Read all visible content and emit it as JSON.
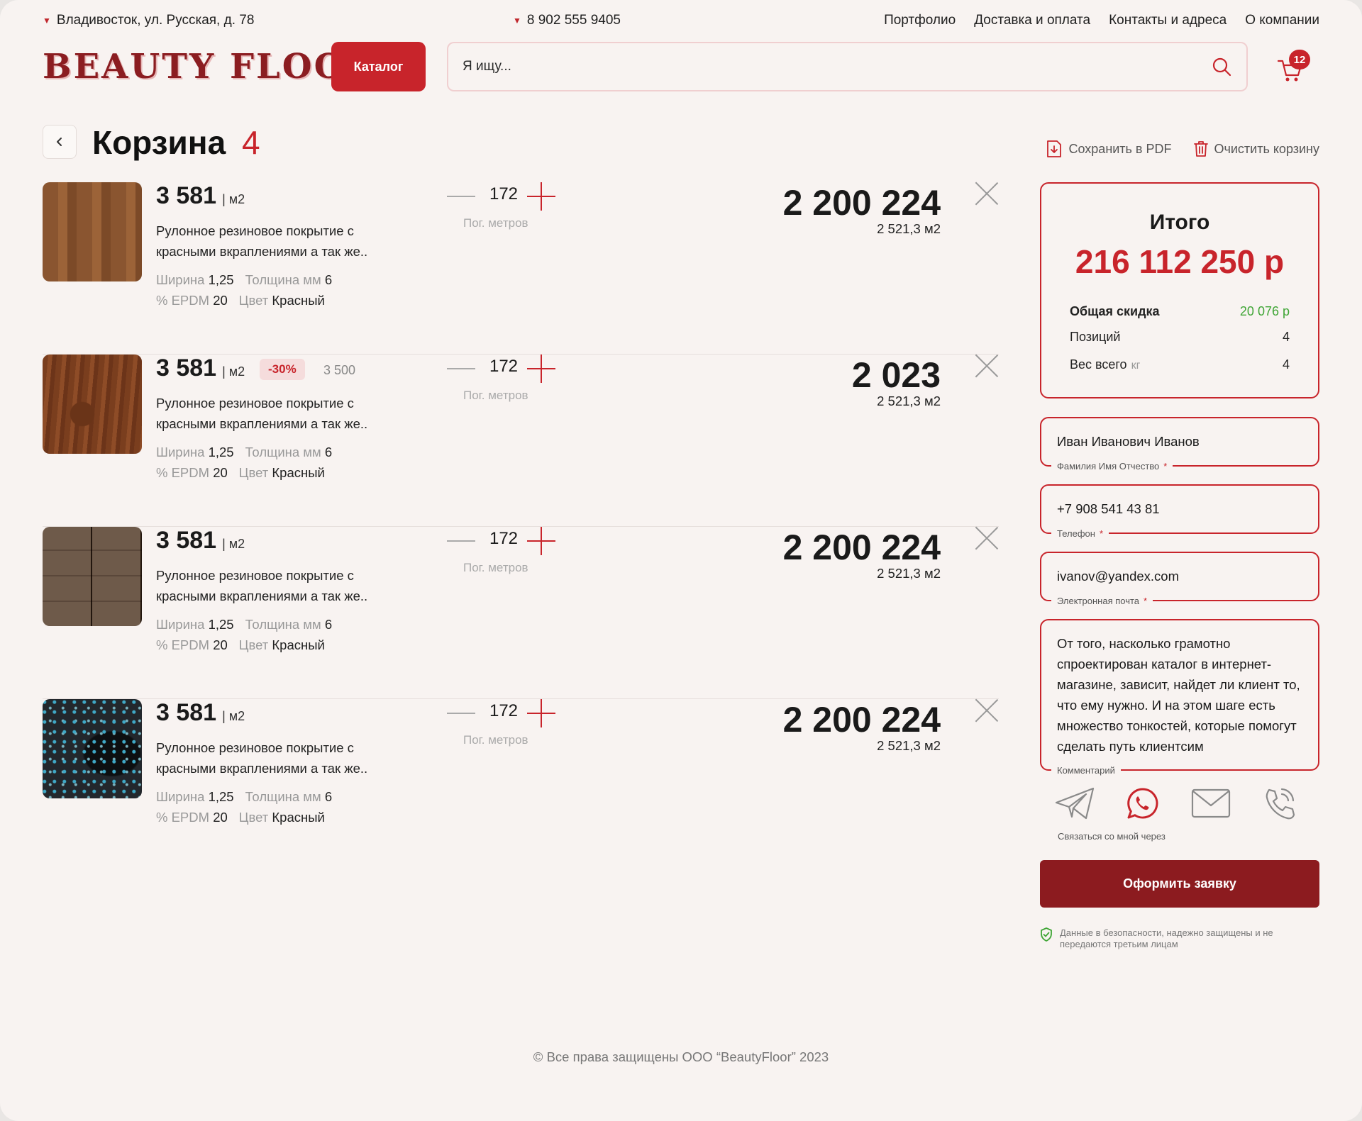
{
  "topbar": {
    "address": "Владивосток, ул. Русская, д. 78",
    "phone": "8 902 555 9405",
    "nav": [
      "Портфолио",
      "Доставка и оплата",
      "Контакты и адреса",
      "О компании"
    ]
  },
  "header": {
    "logo": "BEAUTY FLOOR",
    "catalog_label": "Каталог",
    "search_placeholder": "Я ищу...",
    "cart_count": "12"
  },
  "cart": {
    "title": "Корзина",
    "count": "4",
    "save_pdf": "Сохранить в PDF",
    "clear": "Очистить корзину",
    "items": [
      {
        "price": "3 581",
        "unit": "| м2",
        "discount": "",
        "old_price": "",
        "description": "Рулонное резиновое покрытие с красными вкраплениями а так же..",
        "width_label": "Ширина",
        "width": "1,25",
        "thickness_label": "Толщина мм",
        "thickness": "6",
        "epdm_label": "% EPDM",
        "epdm": "20",
        "color_label": "Цвет",
        "color": "Красный",
        "qty": "172",
        "qty_label": "Пог. метров",
        "total": "2 200 224",
        "area": "2 521,3 м2"
      },
      {
        "price": "3 581",
        "unit": "| м2",
        "discount": "-30%",
        "old_price": "3 500",
        "description": "Рулонное резиновое покрытие с красными вкраплениями а так же..",
        "width_label": "Ширина",
        "width": "1,25",
        "thickness_label": "Толщина мм",
        "thickness": "6",
        "epdm_label": "% EPDM",
        "epdm": "20",
        "color_label": "Цвет",
        "color": "Красный",
        "qty": "172",
        "qty_label": "Пог. метров",
        "total": "2 023",
        "area": "2 521,3 м2"
      },
      {
        "price": "3 581",
        "unit": "| м2",
        "discount": "",
        "old_price": "",
        "description": "Рулонное резиновое покрытие с красными вкраплениями а так же..",
        "width_label": "Ширина",
        "width": "1,25",
        "thickness_label": "Толщина мм",
        "thickness": "6",
        "epdm_label": "% EPDM",
        "epdm": "20",
        "color_label": "Цвет",
        "color": "Красный",
        "qty": "172",
        "qty_label": "Пог. метров",
        "total": "2 200 224",
        "area": "2 521,3 м2"
      },
      {
        "price": "3 581",
        "unit": "| м2",
        "discount": "",
        "old_price": "",
        "description": "Рулонное резиновое покрытие с красными вкраплениями а так же..",
        "width_label": "Ширина",
        "width": "1,25",
        "thickness_label": "Толщина мм",
        "thickness": "6",
        "epdm_label": "% EPDM",
        "epdm": "20",
        "color_label": "Цвет",
        "color": "Красный",
        "qty": "172",
        "qty_label": "Пог. метров",
        "total": "2 200 224",
        "area": "2 521,3 м2"
      }
    ]
  },
  "summary": {
    "title": "Итого",
    "total": "216 112 250 р",
    "discount_label": "Общая скидка",
    "discount_value": "20 076 р",
    "positions_label": "Позиций",
    "positions_value": "4",
    "weight_label": "Вес всего",
    "weight_unit": "кг",
    "weight_value": "4"
  },
  "form": {
    "name_value": "Иван Иванович Иванов",
    "name_label": "Фамилия Имя Отчество",
    "phone_value": "+7 908 541 43 81",
    "phone_label": "Телефон",
    "email_value": "ivanov@yandex.com",
    "email_label": "Электронная почта",
    "comment_value": "От того, насколько грамотно спроектирован каталог в интернет-магазине, зависит, найдет ли клиент то, что ему нужно. И на этом шаге есть множество тонкостей, которые помогут сделать путь клиентсим",
    "comment_label": "Комментарий",
    "required_mark": "*",
    "contact_via_label": "Связаться со мной через",
    "contact_icons": [
      "telegram-icon",
      "whatsapp-icon",
      "email-icon",
      "phone-icon"
    ],
    "submit_label": "Оформить заявку",
    "secure_text": "Данные в безопасности, надежно защищены и не передаются третьим лицам"
  },
  "footer": {
    "copyright": "© Все права защищены ООО “BeautyFloor” 2023"
  },
  "colors": {
    "accent": "#c8242b",
    "dark_accent": "#8c1b1f",
    "discount_green": "#3fa535",
    "background": "#f8f3f1"
  }
}
